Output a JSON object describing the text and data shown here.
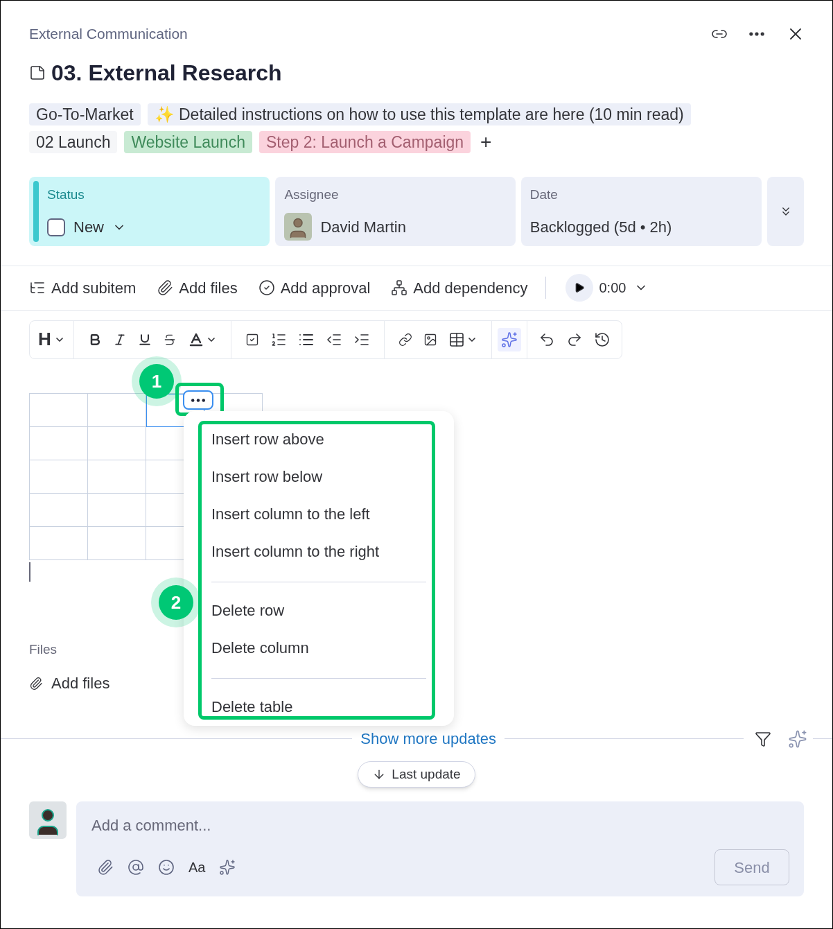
{
  "breadcrumb": "External Communication",
  "title": "03. External Research",
  "tags": [
    [
      {
        "label": "Go-To-Market",
        "color": "#eceff8",
        "kind": "plain"
      },
      {
        "label": "✨ Detailed instructions on how to use this template are here (10 min read)",
        "color": "#eceff8",
        "kind": "plain"
      }
    ],
    [
      {
        "label": "02 Launch",
        "color": "#f5f6f8",
        "kind": "plain"
      },
      {
        "label": "Website Launch",
        "color": "#c8ead3",
        "kind": "green"
      },
      {
        "label": "Step 2: Launch a Campaign",
        "color": "#fbd3dd",
        "kind": "pink"
      }
    ]
  ],
  "add_tag": "+",
  "fields": {
    "status": {
      "label": "Status",
      "value": "New",
      "checked": false
    },
    "assignee": {
      "label": "Assignee",
      "name": "David Martin"
    },
    "date": {
      "label": "Date",
      "value": "Backlogged (5d • 2h)"
    }
  },
  "actions": [
    "Add subitem",
    "Add files",
    "Add approval",
    "Add dependency"
  ],
  "timer": "0:00",
  "editor": {
    "heading": "H",
    "ai_selected": true
  },
  "table": {
    "rows": [
      {
        "cells": [
          {
            "selected": false
          },
          {
            "selected": false
          },
          {
            "selected": true
          },
          {
            "selected": false
          }
        ]
      },
      {
        "cells": [
          {
            "selected": false
          },
          {
            "selected": false
          },
          {
            "selected": false
          }
        ]
      },
      {
        "cells": [
          {
            "selected": false
          },
          {
            "selected": false
          },
          {
            "selected": false
          }
        ]
      },
      {
        "cells": [
          {
            "selected": false
          },
          {
            "selected": false
          },
          {
            "selected": false
          }
        ]
      },
      {
        "cells": [
          {
            "selected": false
          },
          {
            "selected": false
          },
          {
            "selected": false
          }
        ]
      }
    ]
  },
  "menu": {
    "groups": [
      [
        "Insert row above",
        "Insert row below",
        "Insert column to the left",
        "Insert column to the right"
      ],
      [
        "Delete row",
        "Delete column"
      ],
      [
        "Delete table"
      ]
    ]
  },
  "callouts": [
    "1",
    "2"
  ],
  "files": {
    "label": "Files",
    "action": "Add files"
  },
  "updates": {
    "show_more": "Show more updates",
    "last_update": "Last update"
  },
  "comment": {
    "placeholder": "Add a comment...",
    "format": "Aa",
    "send": "Send"
  }
}
